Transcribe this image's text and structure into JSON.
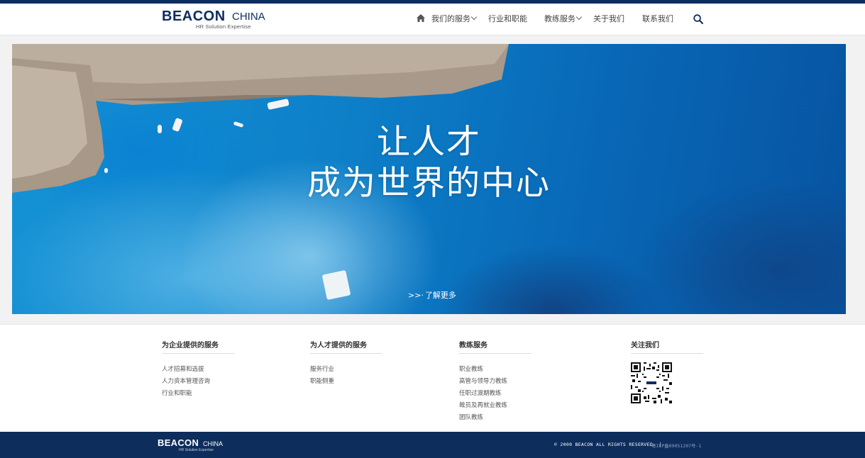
{
  "header": {
    "logo": {
      "main": "BEACON",
      "suffix": "CHINA",
      "tagline": "HR Solution Expertise"
    },
    "nav": [
      {
        "label": "我们的服务",
        "has_dropdown": true
      },
      {
        "label": "行业和职能",
        "has_dropdown": false
      },
      {
        "label": "教练服务",
        "has_dropdown": true
      },
      {
        "label": "关于我们",
        "has_dropdown": false
      },
      {
        "label": "联系我们",
        "has_dropdown": false
      }
    ],
    "icons": {
      "home": "home-icon",
      "search": "search-icon"
    }
  },
  "hero": {
    "headline_line1": "让人才",
    "headline_line2": "成为世界的中心",
    "more_arrows": ">>·",
    "more_label": "了解更多"
  },
  "footer": {
    "columns": [
      {
        "title": "为企业提供的服务",
        "links": [
          "人才招募和选拔",
          "人力资本管理咨询",
          "行业和职能"
        ]
      },
      {
        "title": "为人才提供的服务",
        "links": [
          "服务行业",
          "职能侧重"
        ]
      },
      {
        "title": "教练服务",
        "links": [
          "职业教练",
          "高管与领导力教练",
          "任职过渡期教练",
          "裁员及再就业教练",
          "团队教练"
        ]
      },
      {
        "title": "关注我们",
        "links": []
      }
    ],
    "qr_icon": "qr-code-icon"
  },
  "bottom_bar": {
    "logo": {
      "main": "BEACON",
      "suffix": "CHINA",
      "tagline": "HR Solution Expertise"
    },
    "copyright": "© 2000 BEACON ALL RIGHTS RESERVED. |",
    "icp": "粤ICP备09051207号-1"
  },
  "colors": {
    "brand_navy": "#0d2d5c",
    "hero_blue": "#0d7fc8",
    "white": "#ffffff"
  }
}
